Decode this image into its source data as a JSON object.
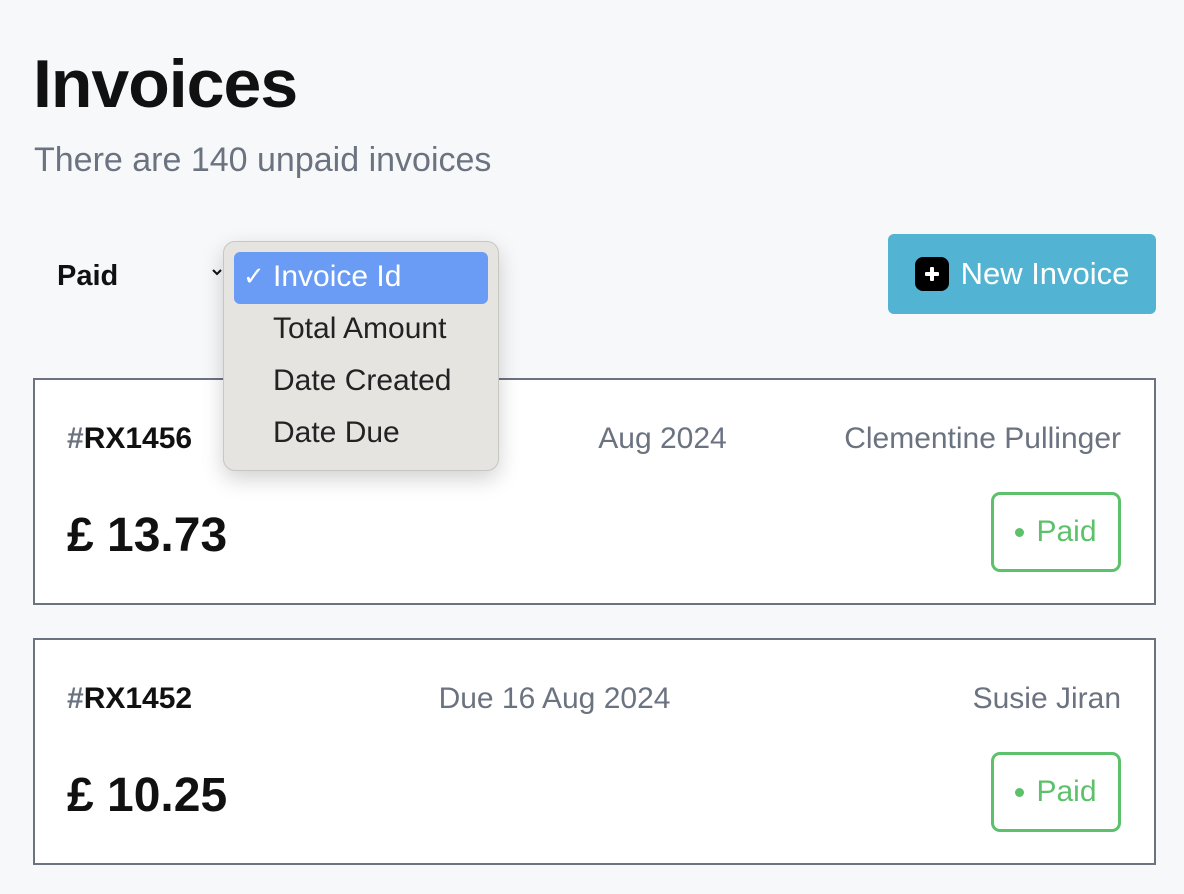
{
  "header": {
    "title": "Invoices",
    "subtitle": "There are 140 unpaid invoices"
  },
  "toolbar": {
    "filter_label": "Paid",
    "filter_chevron_icon": "chevron-down-icon",
    "new_invoice_label": "New Invoice",
    "new_invoice_icon": "plus-square-icon",
    "new_invoice_color": "#52b4d2"
  },
  "sort_dropdown": {
    "check_glyph": "✓",
    "options": [
      {
        "label": "Invoice Id",
        "selected": true
      },
      {
        "label": "Total Amount",
        "selected": false
      },
      {
        "label": "Date Created",
        "selected": false
      },
      {
        "label": "Date Due",
        "selected": false
      }
    ],
    "highlight_color": "#6a9cf5"
  },
  "invoices": [
    {
      "hash": "#",
      "id": "RX1456",
      "due": "Aug 2024",
      "client": "Clementine Pullinger",
      "currency": "£",
      "amount": "13.73",
      "amount_display": "£ 13.73",
      "status": "Paid"
    },
    {
      "hash": "#",
      "id": "RX1452",
      "due": "Due 16 Aug 2024",
      "client": "Susie Jiran",
      "currency": "£",
      "amount": "10.25",
      "amount_display": "£ 10.25",
      "status": "Paid"
    }
  ],
  "colors": {
    "background": "#f7f8fa",
    "muted_text": "#6b7280",
    "paid_green": "#5cc16a"
  }
}
